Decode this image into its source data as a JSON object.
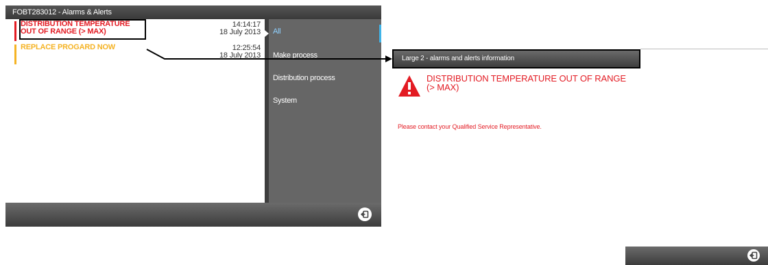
{
  "window": {
    "title": "FOBT283012 - Alarms & Alerts"
  },
  "alarms": [
    {
      "title": "DISTRIBUTION TEMPERATURE OUT OF RANGE (> MAX)",
      "time": "14:14:17",
      "date": "18 July 2013",
      "color": "#e31b23"
    },
    {
      "title": "REPLACE PROGARD NOW",
      "time": "12:25:54",
      "date": "18 July 2013",
      "color": "#f5b324"
    }
  ],
  "categories": [
    {
      "label": "All",
      "active": true
    },
    {
      "label": "Make process"
    },
    {
      "label": "Distribution process"
    },
    {
      "label": "System"
    }
  ],
  "footer": {
    "exit_icon": "exit-icon"
  },
  "info_panel": {
    "header": "Large 2 - alarms and alerts information",
    "title": "DISTRIBUTION TEMPERATURE OUT OF RANGE (> MAX)",
    "message": "Please contact your Qualified Service Representative.",
    "icon": "warning-icon",
    "accent_color": "#e31b23"
  }
}
